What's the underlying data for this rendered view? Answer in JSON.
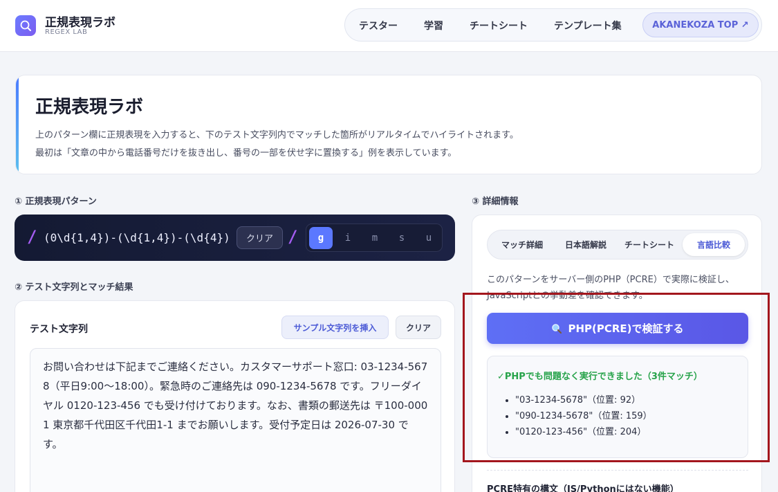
{
  "header": {
    "title": "正規表現ラボ",
    "subtitle": "REGEX LAB",
    "nav": [
      "テスター",
      "学習",
      "チートシート",
      "テンプレート集"
    ],
    "top_link": "AKANEKOZA TOP ↗"
  },
  "intro": {
    "title": "正規表現ラボ",
    "line1": "上のパターン欄に正規表現を入力すると、下のテスト文字列内でマッチした箇所がリアルタイムでハイライトされます。",
    "line2": "最初は「文章の中から電話番号だけを抜き出し、番号の一部を伏せ字に置換する」例を表示しています。"
  },
  "pattern": {
    "label": "① 正規表現パターン",
    "slash": "/",
    "value": "(0\\d{1,4})-(\\d{1,4})-(\\d{4})",
    "clear_label": "クリア",
    "flags": [
      "g",
      "i",
      "m",
      "s",
      "u"
    ],
    "active_flag": "g"
  },
  "test": {
    "label": "② テスト文字列とマッチ結果",
    "title": "テスト文字列",
    "sample_button": "サンプル文字列を挿入",
    "clear_button": "クリア",
    "text": "お問い合わせは下記までご連絡ください。カスタマーサポート窓口: 03-1234-5678（平日9:00〜18:00）。緊急時のご連絡先は 090-1234-5678 です。フリーダイヤル 0120-123-456 でも受け付けております。なお、書類の郵送先は 〒100-0001 東京都千代田区千代田1-1 までお願いします。受付予定日は 2026-07-30 です。"
  },
  "detail": {
    "label": "③ 詳細情報",
    "tabs": [
      "マッチ詳細",
      "日本語解説",
      "チートシート",
      "言語比較"
    ],
    "active_tab": "言語比較",
    "description": "このパターンをサーバー側のPHP（PCRE）で実際に検証し、JavaScriptとの挙動差を確認できます。",
    "verify_button": "PHP(PCRE)で検証する",
    "verify_icon": "magnifier-icon",
    "result_title": "✓PHPでも問題なく実行できました（3件マッチ）",
    "results": [
      "\"03-1234-5678\"（位置: 92）",
      "\"090-1234-5678\"（位置: 159）",
      "\"0120-123-456\"（位置: 204）"
    ],
    "pcre_title": "PCRE特有の構文（JS/Pythonにはない機能）"
  },
  "colors": {
    "accent": "#5b63d8",
    "success": "#27a34a",
    "highlight_border": "#a3161d",
    "pattern_bg": "#141a33"
  }
}
